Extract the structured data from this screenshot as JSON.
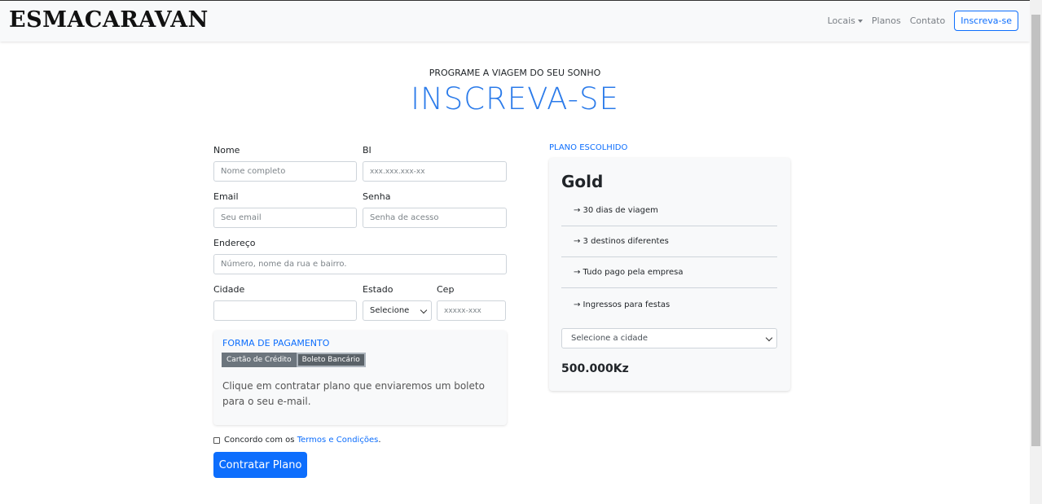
{
  "navbar": {
    "brand": "ESMACARAVAN",
    "links": [
      "Locais",
      "Planos",
      "Contato"
    ],
    "cta": "Inscreva-se"
  },
  "header": {
    "subtitle": "PROGRAME A VIAGEM DO SEU SONHO",
    "title": "INSCREVA-SE"
  },
  "form": {
    "nome": {
      "label": "Nome",
      "placeholder": "Nome completo"
    },
    "bi": {
      "label": "BI",
      "placeholder": "xxx.xxx.xxx-xx"
    },
    "email": {
      "label": "Email",
      "placeholder": "Seu email"
    },
    "senha": {
      "label": "Senha",
      "placeholder": "Senha de acesso"
    },
    "endereco": {
      "label": "Endereço",
      "placeholder": "Número, nome da rua e bairro."
    },
    "cidade": {
      "label": "Cidade",
      "value": ""
    },
    "estado": {
      "label": "Estado",
      "value": "Selecione"
    },
    "cep": {
      "label": "Cep",
      "placeholder": "xxxxx-xxx"
    },
    "payment": {
      "title": "FORMA DE PAGAMENTO",
      "tabs": [
        "Cartão de Crédito",
        "Boleto Bancário"
      ],
      "active_tab": "Boleto Bancário",
      "text": "Clique em contratar plano que enviaremos um boleto para o seu e-mail."
    },
    "agree": {
      "prefix": "Concordo com os ",
      "link": "Termos e Condições",
      "suffix": "."
    },
    "submit": "Contratar Plano"
  },
  "plan": {
    "label": "PLANO ESCOLHIDO",
    "name": "Gold",
    "items": [
      "→ 30 dias de viagem",
      "→ 3 destinos diferentes",
      "→ Tudo pago pela empresa",
      "→ Ingressos para festas"
    ],
    "select": "Selecione a cidade",
    "price": "500.000Kz"
  },
  "colors": {
    "accent": "#0d6efd",
    "title": "#2b7bea"
  }
}
